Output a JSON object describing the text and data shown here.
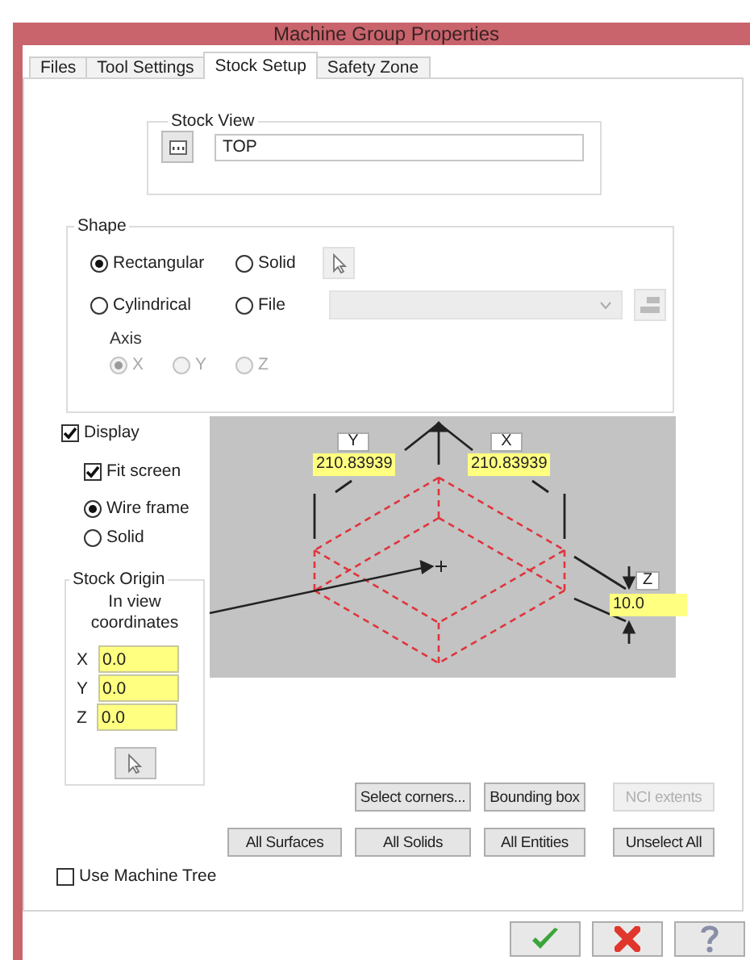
{
  "window": {
    "title": "Machine Group Properties"
  },
  "tabs": [
    {
      "label": "Files",
      "selected": false
    },
    {
      "label": "Tool Settings",
      "selected": false
    },
    {
      "label": "Stock Setup",
      "selected": true
    },
    {
      "label": "Safety Zone",
      "selected": false
    }
  ],
  "stock_view": {
    "title": "Stock View",
    "value": "TOP"
  },
  "shape": {
    "title": "Shape",
    "options": [
      {
        "label": "Rectangular",
        "selected": true
      },
      {
        "label": "Solid",
        "selected": false
      },
      {
        "label": "Cylindrical",
        "selected": false
      },
      {
        "label": "File",
        "selected": false
      }
    ],
    "axis": {
      "label": "Axis",
      "disabled": true,
      "options": [
        {
          "label": "X",
          "selected": true
        },
        {
          "label": "Y",
          "selected": false
        },
        {
          "label": "Z",
          "selected": false
        }
      ]
    }
  },
  "display": {
    "label": "Display",
    "checked": true
  },
  "fit_screen": {
    "label": "Fit screen",
    "checked": true
  },
  "render_modes": [
    {
      "label": "Wire frame",
      "selected": true
    },
    {
      "label": "Solid",
      "selected": false
    }
  ],
  "stock_origin": {
    "title": "Stock Origin",
    "subtitle": "In view coordinates",
    "fields": [
      {
        "label": "X",
        "value": "0.0"
      },
      {
        "label": "Y",
        "value": "0.0"
      },
      {
        "label": "Z",
        "value": "0.0"
      }
    ]
  },
  "preview": {
    "y_label": "Y",
    "y_value": "210.83939",
    "x_label": "X",
    "x_value": "210.83939",
    "z_label": "Z",
    "z_value": "10.0"
  },
  "action_buttons": [
    {
      "label": "Select corners...",
      "disabled": false
    },
    {
      "label": "Bounding box",
      "disabled": false
    },
    {
      "label": "NCI extents",
      "disabled": true
    },
    {
      "label": "All Surfaces",
      "disabled": false
    },
    {
      "label": "All Solids",
      "disabled": false
    },
    {
      "label": "All Entities",
      "disabled": false
    },
    {
      "label": "Unselect All",
      "disabled": false
    }
  ],
  "use_machine_tree": {
    "label": "Use Machine Tree",
    "checked": false
  }
}
